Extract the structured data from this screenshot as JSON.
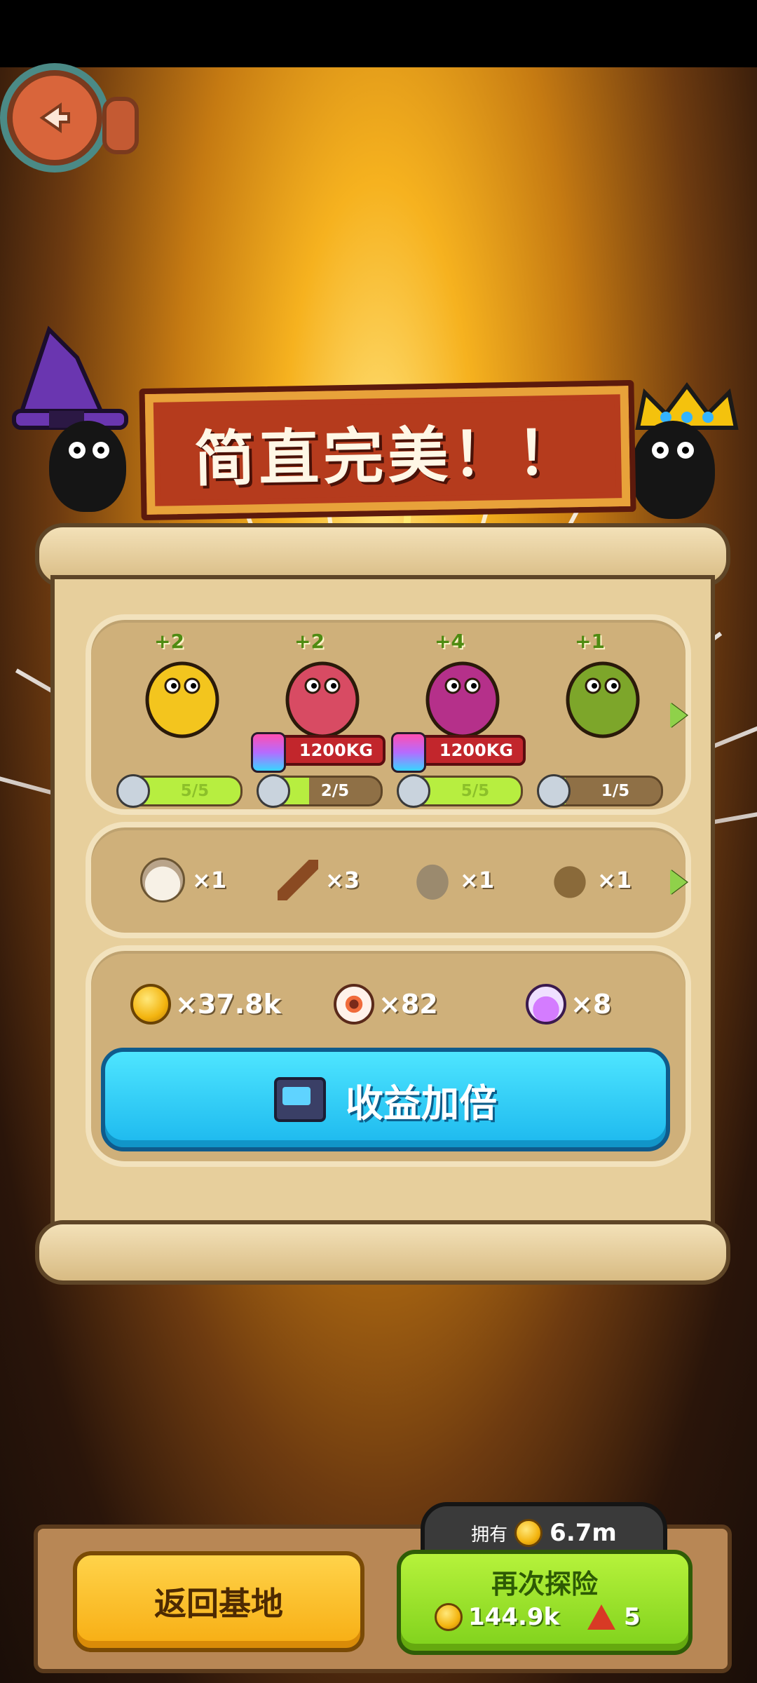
{
  "banner": {
    "title": "简直完美！！"
  },
  "monsters": [
    {
      "plus": "+2",
      "weight": "",
      "level_text": "5/5",
      "level_fraction": 1.0,
      "color": "#f3c51e"
    },
    {
      "plus": "+2",
      "weight": "1200KG",
      "level_text": "2/5",
      "level_fraction": 0.4,
      "color": "#d84b63"
    },
    {
      "plus": "+4",
      "weight": "1200KG",
      "level_text": "5/5",
      "level_fraction": 1.0,
      "color": "#b5308a"
    },
    {
      "plus": "+1",
      "weight": "",
      "level_text": "1/5",
      "level_fraction": 0.2,
      "color": "#7da62a"
    }
  ],
  "items": [
    {
      "icon": "garlic-icon",
      "count": "×1"
    },
    {
      "icon": "branch-icon",
      "count": "×3"
    },
    {
      "icon": "bug-shell-icon",
      "count": "×1"
    },
    {
      "icon": "beetle-icon",
      "count": "×1"
    }
  ],
  "rewards": [
    {
      "icon": "gold-coin-icon",
      "count": "×37.8k"
    },
    {
      "icon": "eyeball-icon",
      "count": "×82"
    },
    {
      "icon": "potion-icon",
      "count": "×8"
    }
  ],
  "double_button": {
    "label": "收益加倍"
  },
  "owned": {
    "label": "拥有",
    "value": "6.7m"
  },
  "return_button": {
    "label": "返回基地"
  },
  "again_button": {
    "label": "再次探险",
    "coin_cost": "144.9k",
    "ticket_cost": "5"
  },
  "colors": {
    "accent_green": "#8fd14a",
    "button_blue": "#1cb8ee",
    "button_yellow": "#f7ad12"
  }
}
